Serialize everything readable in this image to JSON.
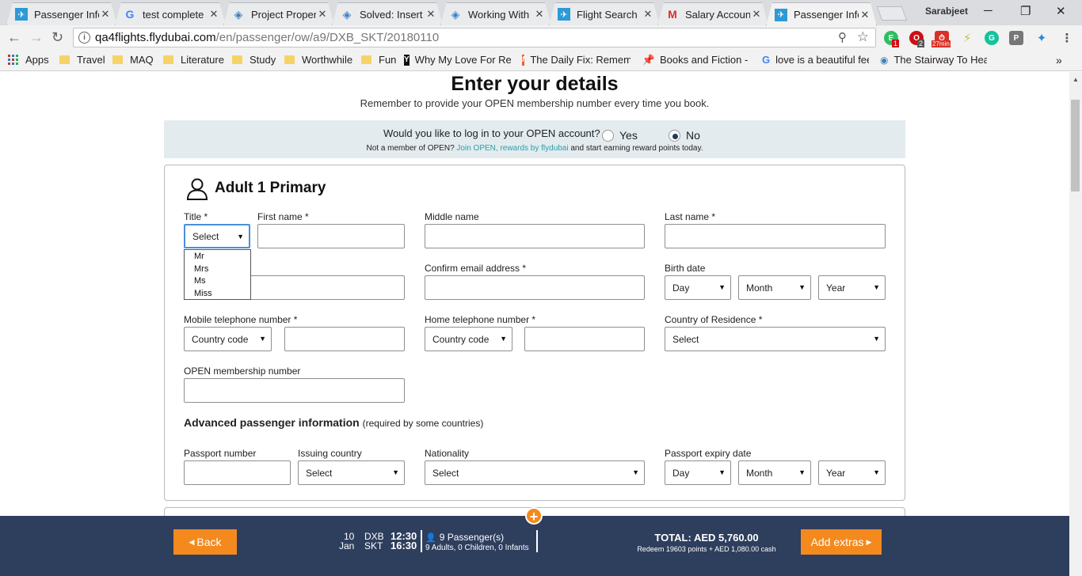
{
  "browser": {
    "tabs": [
      {
        "title": "Passenger Info",
        "icon": "flydubai-icon",
        "active": false
      },
      {
        "title": "test complete",
        "icon": "google-icon",
        "active": false
      },
      {
        "title": "Project Proper",
        "icon": "diamond-icon",
        "active": false
      },
      {
        "title": "Solved: Insert",
        "icon": "diamond-icon",
        "active": false
      },
      {
        "title": "Working With",
        "icon": "diamond-icon",
        "active": false
      },
      {
        "title": "Flight Search",
        "icon": "flydubai-icon",
        "active": false
      },
      {
        "title": "Salary Accoun",
        "icon": "gmail-icon",
        "active": false
      },
      {
        "title": "Passenger Info",
        "icon": "flydubai-icon",
        "active": true
      }
    ],
    "profile_name": "Sarabjeet",
    "url_host": "qa4flights.flydubai.com",
    "url_path": "/en/passenger/ow/a9/DXB_SKT/20180110",
    "extensions": [
      {
        "name": "evernote-ext-icon",
        "badge": "1",
        "color": "#2dbe60"
      },
      {
        "name": "opera-ext-icon",
        "badge": "2",
        "color": "#cc0f16"
      },
      {
        "name": "timer-ext-icon",
        "badge": "27min",
        "color": "#d93025"
      },
      {
        "name": "bolt-ext-icon",
        "badge": "",
        "color": "#c9c23b"
      },
      {
        "name": "grammarly-ext-icon",
        "badge": "",
        "color": "#15c39a"
      },
      {
        "name": "pocket-ext-icon",
        "badge": "",
        "color": "#777777"
      },
      {
        "name": "share-ext-icon",
        "badge": "",
        "color": "#2a8bd8"
      }
    ],
    "bookmarks": [
      {
        "label": "Apps",
        "kind": "apps"
      },
      {
        "label": "Travel",
        "kind": "folder"
      },
      {
        "label": "MAQ",
        "kind": "folder"
      },
      {
        "label": "Literature",
        "kind": "folder"
      },
      {
        "label": "Study",
        "kind": "folder"
      },
      {
        "label": "Worthwhile",
        "kind": "folder"
      },
      {
        "label": "Fun",
        "kind": "folder"
      },
      {
        "label": "Why My Love For Re",
        "kind": "site",
        "icon": "Y",
        "color": "#111111"
      },
      {
        "label": "The Daily Fix: Remem",
        "kind": "site",
        "icon": "f",
        "color": "#e8612c"
      },
      {
        "label": "Books and Fiction - T",
        "kind": "site",
        "icon": "pin",
        "color": "#333333"
      },
      {
        "label": "love is a beautiful fee",
        "kind": "site",
        "icon": "G",
        "color": "#4285f4"
      },
      {
        "label": "The Stairway To Heav",
        "kind": "site",
        "icon": "loc",
        "color": "#3b82c4"
      }
    ],
    "overflow_glyph": "»"
  },
  "page": {
    "heading": "Enter your details",
    "subheading": "Remember to provide your OPEN membership number every time you book.",
    "login": {
      "question": "Would you like to log in to your OPEN account?",
      "yes_label": "Yes",
      "no_label": "No",
      "selected": "No",
      "note_before": "Not a member of OPEN?",
      "note_link": "Join OPEN, rewards by flydubai",
      "note_after": "and start earning reward points today."
    },
    "passenger": {
      "title": "Adult 1 Primary",
      "title_label": "Title *",
      "title_value": "Select",
      "title_options": [
        "Mr",
        "Mrs",
        "Ms",
        "Miss"
      ],
      "first_name_label": "First name *",
      "middle_name_label": "Middle name",
      "last_name_label": "Last name *",
      "confirm_email_label": "Confirm email address *",
      "birth_date_label": "Birth date",
      "day_value": "Day",
      "month_value": "Month",
      "year_value": "Year",
      "mobile_label": "Mobile telephone number *",
      "home_label": "Home telephone number *",
      "country_code_value": "Country code",
      "residence_label": "Country of Residence *",
      "residence_value": "Select",
      "open_label": "OPEN membership number",
      "api_title": "Advanced passenger information",
      "api_note": "(required by some countries)",
      "passport_label": "Passport number",
      "issuing_label": "Issuing country",
      "issuing_value": "Select",
      "nationality_label": "Nationality",
      "nationality_value": "Select",
      "expiry_label": "Passport expiry date"
    }
  },
  "footer": {
    "back_label": "Back",
    "day": "10",
    "month": "Jan",
    "from": "DXB",
    "to": "SKT",
    "depart": "12:30",
    "arrive": "16:30",
    "passengers": "9 Passenger(s)",
    "breakdown": "9 Adults, 0 Children, 0 Infants",
    "total": "TOTAL: AED 5,760.00",
    "redeem": "Redeem 19603 points + AED 1,080.00 cash",
    "add_extras_label": "Add extras"
  },
  "colors": {
    "accent_orange": "#f48a1e",
    "footer_navy": "#2e3e5d",
    "link_teal": "#2aa0a8",
    "login_bar": "#e3ebef"
  }
}
